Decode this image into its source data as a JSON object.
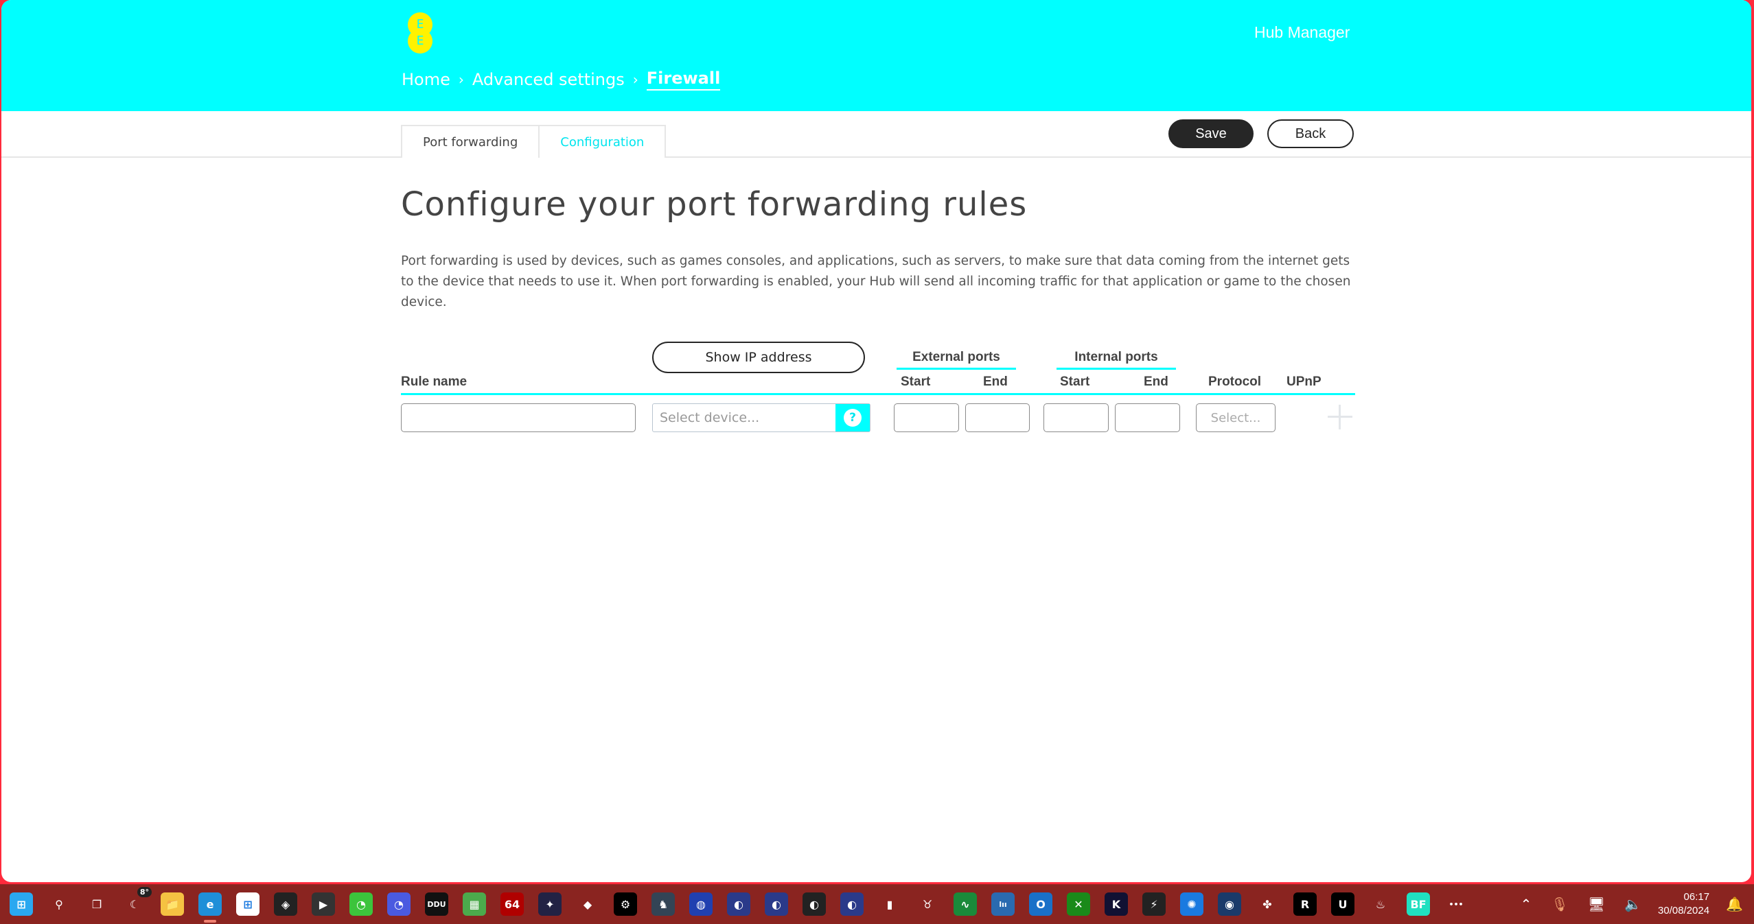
{
  "header": {
    "logo_letters": [
      "E",
      "E"
    ],
    "app_title": "Hub Manager",
    "breadcrumb": [
      {
        "label": "Home"
      },
      {
        "label": "Advanced settings"
      },
      {
        "label": "Firewall"
      }
    ],
    "breadcrumb_separator": "›"
  },
  "colors": {
    "brand": "#00ffff",
    "logo": "#fff200",
    "primary_button": "#262626"
  },
  "tabs": [
    {
      "label": "Port forwarding",
      "active": false
    },
    {
      "label": "Configuration",
      "active": true
    }
  ],
  "actions": {
    "save_label": "Save",
    "back_label": "Back"
  },
  "main": {
    "title": "Configure your port forwarding rules",
    "description": "Port forwarding is used by devices, such as games consoles, and applications, such as servers, to make sure that data coming from the internet gets to the device that needs to use it. When port forwarding is enabled, your Hub will send all incoming traffic for that application or game to the chosen device."
  },
  "rules_table": {
    "show_ip_label": "Show IP address",
    "headers": {
      "rule_name": "Rule name",
      "external_ports": "External ports",
      "internal_ports": "Internal ports",
      "start": "Start",
      "end": "End",
      "protocol": "Protocol",
      "upnp": "UPnP"
    },
    "new_row": {
      "rule_name": "",
      "device_placeholder": "Select device...",
      "help_glyph": "?",
      "ext_start": "",
      "ext_end": "",
      "int_start": "",
      "int_end": "",
      "protocol_placeholder": "Select..."
    }
  },
  "taskbar": {
    "weather_temp": "8°",
    "apps": [
      {
        "icon": "windows-start-icon",
        "glyph": "⊞",
        "bg": "#2aa8f0"
      },
      {
        "icon": "search-icon",
        "glyph": "⚲",
        "bg": "transparent"
      },
      {
        "icon": "task-view-icon",
        "glyph": "❐",
        "bg": "transparent"
      },
      {
        "icon": "weather-icon",
        "glyph": "☾",
        "bg": "transparent"
      },
      {
        "icon": "file-explorer-icon",
        "glyph": "📁",
        "bg": "#f5c242"
      },
      {
        "icon": "edge-browser-icon",
        "glyph": "e",
        "bg": "#1f8fd8",
        "active": true
      },
      {
        "icon": "microsoft-store-icon",
        "glyph": "⊞",
        "bg": "#ffffff"
      },
      {
        "icon": "icue-icon",
        "glyph": "◈",
        "bg": "#222222"
      },
      {
        "icon": "media-player-icon",
        "glyph": "▶",
        "bg": "#333333"
      },
      {
        "icon": "disk-benchmark-icon",
        "glyph": "◔",
        "bg": "#3cc43c"
      },
      {
        "icon": "system-benchmark-icon",
        "glyph": "◔",
        "bg": "#4a5ae0"
      },
      {
        "icon": "ddu-icon",
        "glyph": "DDU",
        "bg": "#111111"
      },
      {
        "icon": "gpu-tool-icon",
        "glyph": "▦",
        "bg": "#4caa4c"
      },
      {
        "icon": "aida64-icon",
        "glyph": "64",
        "bg": "#b00000"
      },
      {
        "icon": "rocket-app-icon",
        "glyph": "✦",
        "bg": "#222244"
      },
      {
        "icon": "msi-afterburner-icon",
        "glyph": "◆",
        "bg": "transparent"
      },
      {
        "icon": "settings-gear-icon",
        "glyph": "⚙",
        "bg": "#000000"
      },
      {
        "icon": "armoury-icon",
        "glyph": "♞",
        "bg": "#334455"
      },
      {
        "icon": "globe-app-icon",
        "glyph": "◍",
        "bg": "#2040b0"
      },
      {
        "icon": "cinema4d-icon",
        "glyph": "◐",
        "bg": "#2a3a8a"
      },
      {
        "icon": "cinema4d-icon-2",
        "glyph": "◐",
        "bg": "#2a3a8a"
      },
      {
        "icon": "cinema4d-icon-3",
        "glyph": "◐",
        "bg": "#222222"
      },
      {
        "icon": "cinema4d-icon-4",
        "glyph": "◐",
        "bg": "#2a3a8a"
      },
      {
        "icon": "mouse-software-icon",
        "glyph": "▮",
        "bg": "transparent"
      },
      {
        "icon": "redragon-icon",
        "glyph": "♉",
        "bg": "transparent"
      },
      {
        "icon": "health-monitor-icon",
        "glyph": "∿",
        "bg": "#1a8a3a"
      },
      {
        "icon": "equalizer-app-icon",
        "glyph": "lıı",
        "bg": "#2a6ab0"
      },
      {
        "icon": "outlook-icon",
        "glyph": "O",
        "bg": "#1a70c8"
      },
      {
        "icon": "xbox-icon",
        "glyph": "✕",
        "bg": "#1a8a1a"
      },
      {
        "icon": "kodi-like-icon",
        "glyph": "K",
        "bg": "#111133"
      },
      {
        "icon": "speed-app-icon",
        "glyph": "⚡",
        "bg": "#222222"
      },
      {
        "icon": "battlenet-icon",
        "glyph": "✺",
        "bg": "#1a7ae0"
      },
      {
        "icon": "steam-icon",
        "glyph": "◉",
        "bg": "#1a3a6a"
      },
      {
        "icon": "fan-control-icon",
        "glyph": "✤",
        "bg": "transparent"
      },
      {
        "icon": "rockstar-icon",
        "glyph": "R",
        "bg": "#000000"
      },
      {
        "icon": "unreal-engine-icon",
        "glyph": "U",
        "bg": "#000000"
      },
      {
        "icon": "flame-app-icon",
        "glyph": "♨",
        "bg": "transparent"
      },
      {
        "icon": "bf-game-icon",
        "glyph": "BF",
        "bg": "#20e0c0"
      },
      {
        "icon": "more-apps-icon",
        "glyph": "•••",
        "bg": "transparent"
      }
    ],
    "tray": {
      "chevron": "⌃",
      "mic": "🎙",
      "network": "🖥",
      "volume": "🔈",
      "time": "06:17",
      "date": "30/08/2024",
      "notification": "🔔"
    }
  }
}
